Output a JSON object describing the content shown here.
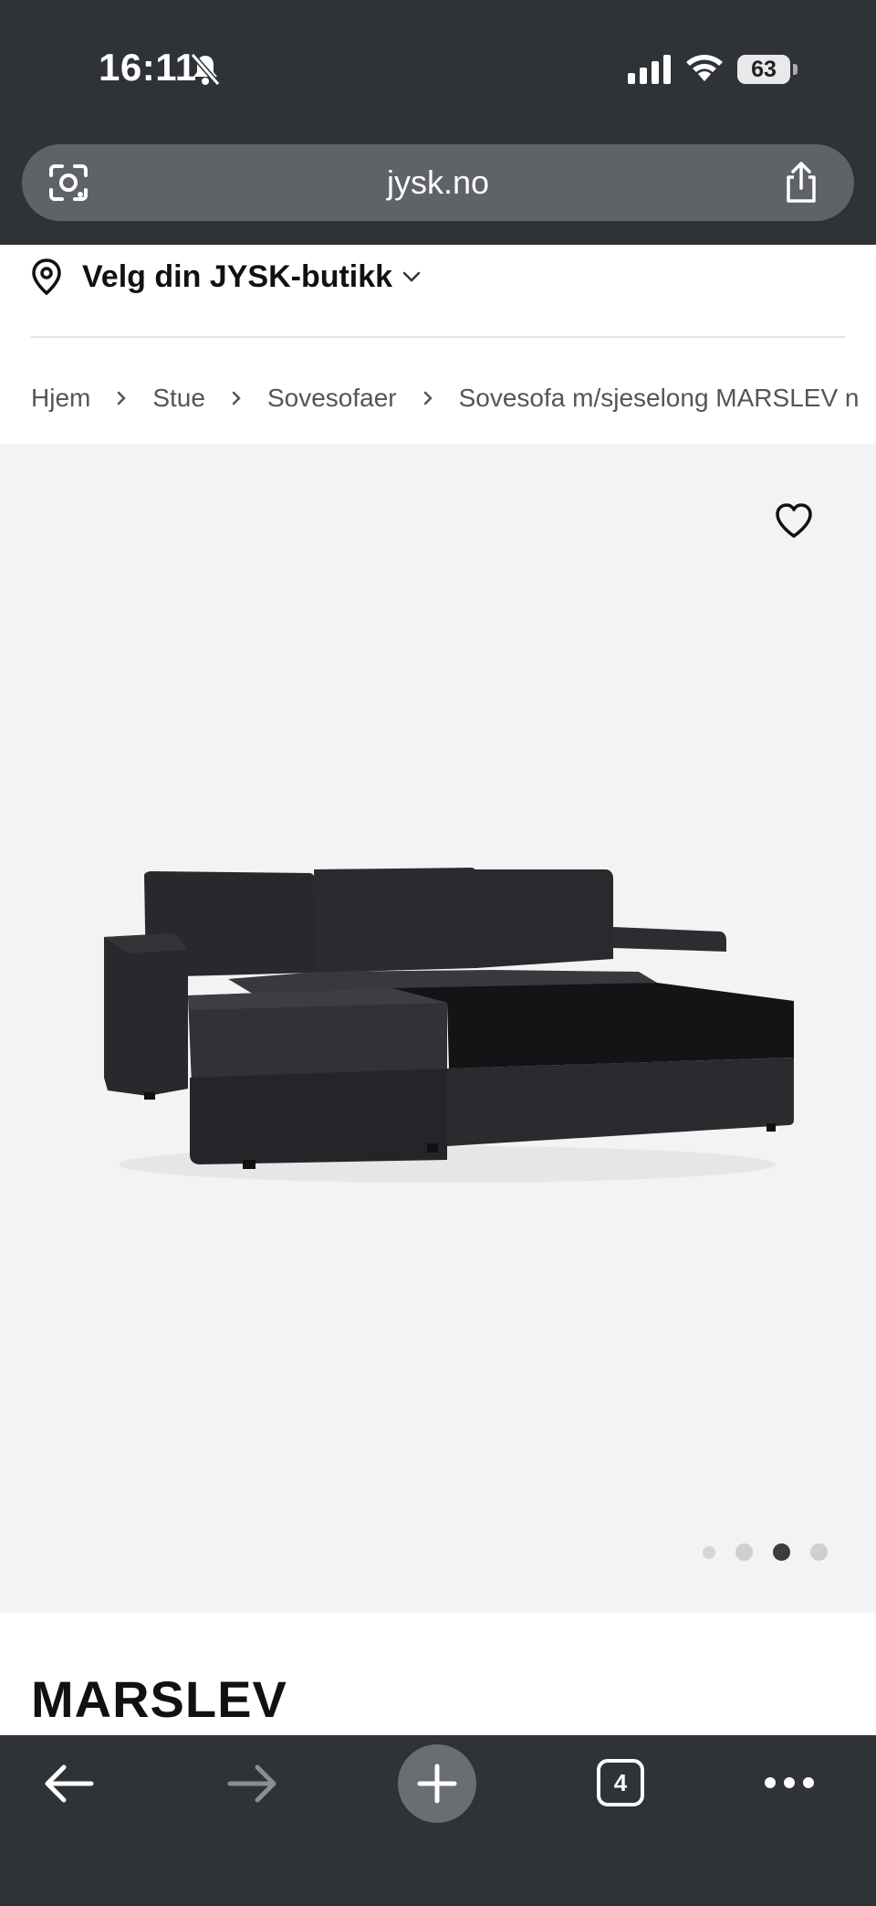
{
  "status": {
    "time": "16:11",
    "battery": "63"
  },
  "browser": {
    "url": "jysk.no"
  },
  "store": {
    "label": "Velg din JYSK-butikk"
  },
  "breadcrumb": [
    "Hjem",
    "Stue",
    "Sovesofaer",
    "Sovesofa m/sjeselong MARSLEV n"
  ],
  "gallery": {
    "image_count": 4,
    "active_index": 2
  },
  "product": {
    "title": "MARSLEV"
  },
  "toolbar": {
    "tab_count": "4"
  },
  "colors": {
    "chrome_bg": "#2f3236",
    "url_pill": "#5f6266",
    "gallery_bg": "#f3f3f3"
  }
}
